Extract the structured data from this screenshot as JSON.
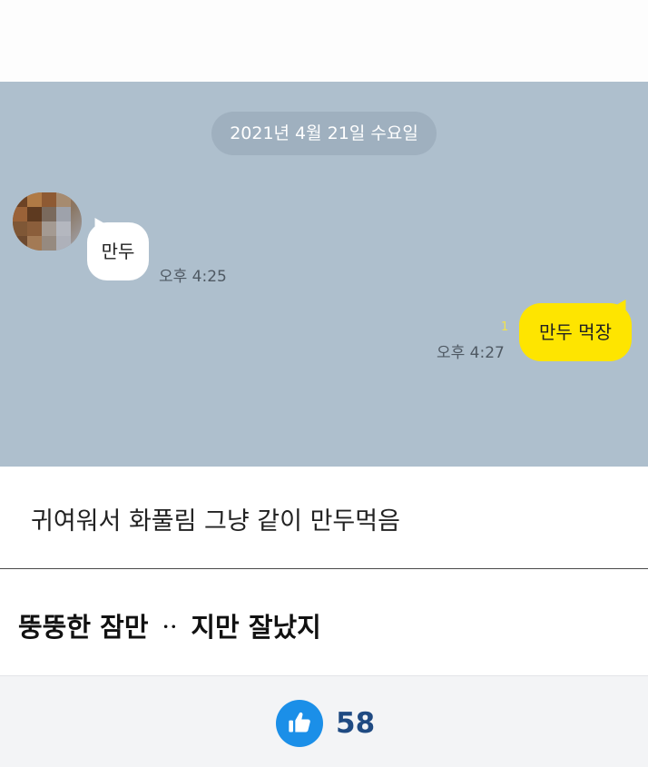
{
  "chat": {
    "date": "2021년 4월 21일 수요일",
    "incoming": {
      "text": "만두",
      "time": "오후 4:25"
    },
    "outgoing": {
      "text": "만두 먹장",
      "time": "오후 4:27",
      "unread": "1"
    }
  },
  "caption": "귀여워서 화풀림 그냥 같이 만두먹음",
  "comment": "뚱뚱한 잠만 ᆢ 지만 잘났지",
  "like": {
    "count": "58",
    "icon": "thumbs-up-icon"
  },
  "colors": {
    "chat_bg": "#aebfcd",
    "outgoing_bubble": "#fee500",
    "incoming_bubble": "#ffffff",
    "like_button": "#1b8fe8",
    "like_count": "#1f4a82"
  }
}
